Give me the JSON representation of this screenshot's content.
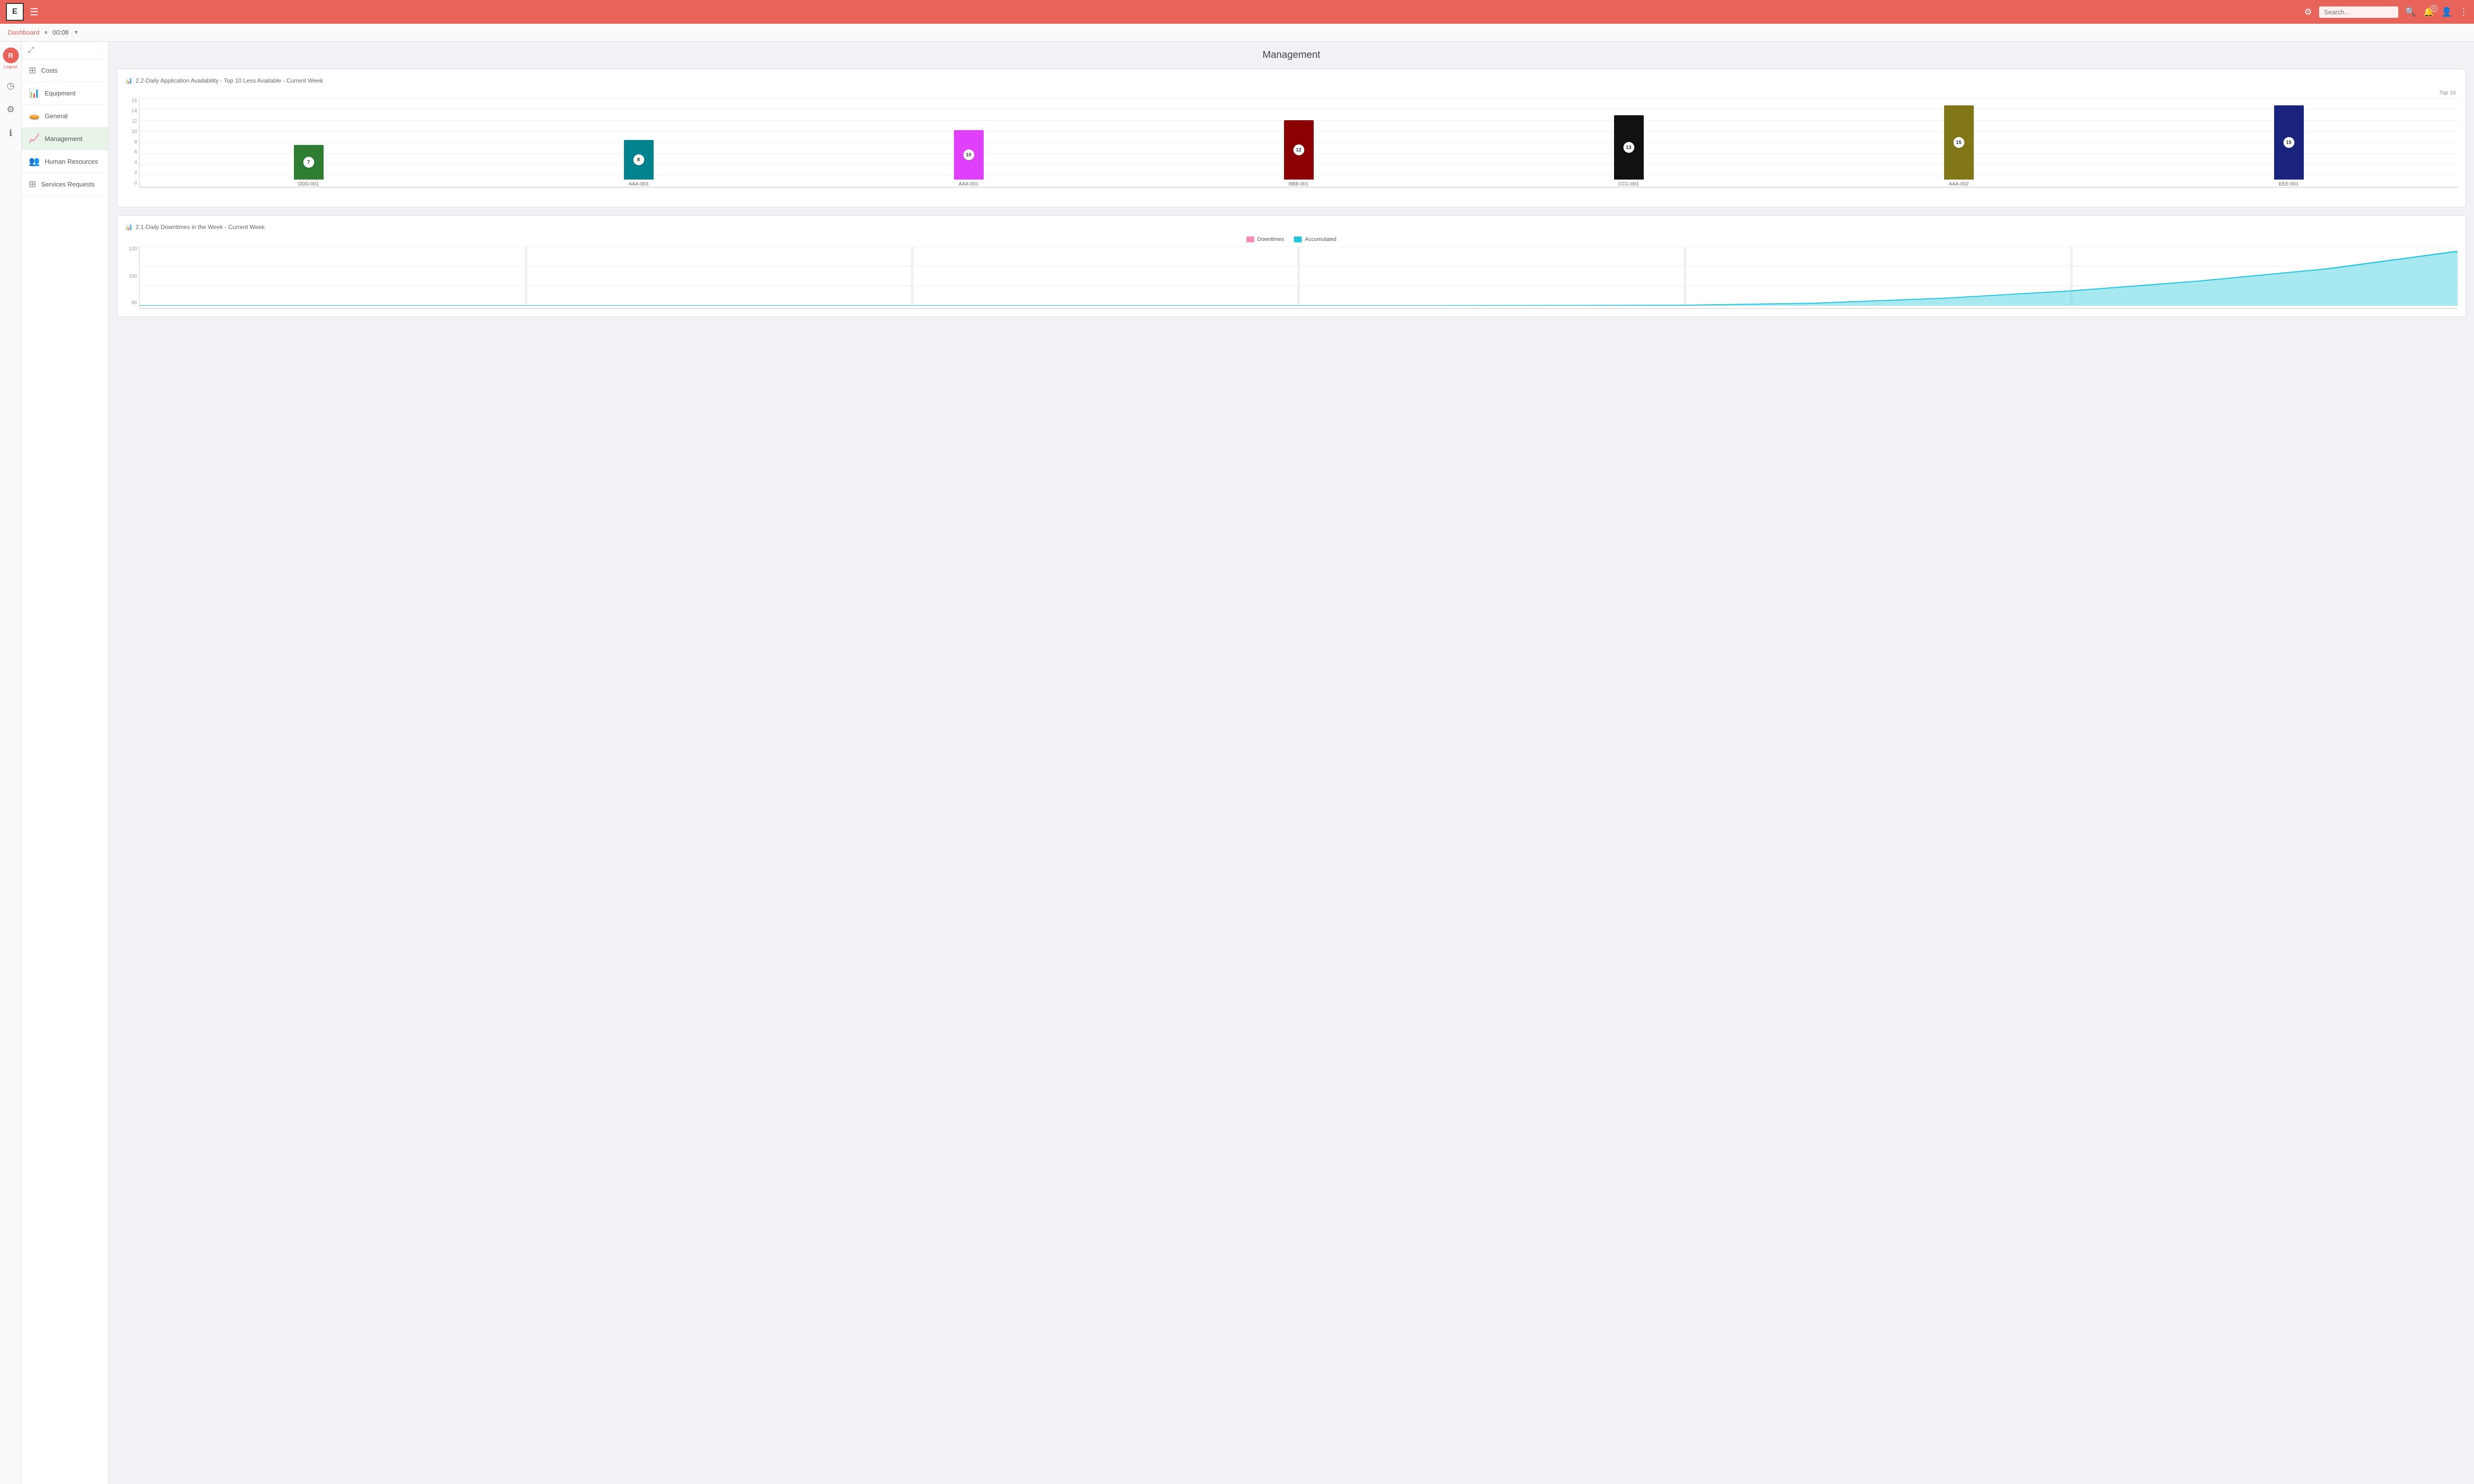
{
  "app": {
    "logo": "E",
    "title": "Management Dashboard"
  },
  "topnav": {
    "hamburger": "☰",
    "search_placeholder": "Search...",
    "settings_icon": "⚙",
    "search_icon": "🔍",
    "bell_icon": "🔔",
    "bell_badge": "0",
    "user_icon": "👤",
    "more_icon": "⋮"
  },
  "breadcrumb": {
    "dashboard_label": "Dashboard",
    "pause_icon": "⏸",
    "time": "00:08",
    "filter_icon": "▼"
  },
  "sidebar_icons": [
    {
      "name": "user-icon",
      "label": "R",
      "sublabel": "Logout",
      "is_user": true
    },
    {
      "name": "clock-icon",
      "label": "◷"
    },
    {
      "name": "settings-icon",
      "label": "⚙"
    },
    {
      "name": "info-icon",
      "label": "ℹ"
    }
  ],
  "nav_items": [
    {
      "id": "costs",
      "label": "Costs",
      "icon": "⊞",
      "icon_color": "#888",
      "active": false
    },
    {
      "id": "equipment",
      "label": "Equipment",
      "icon": "📊",
      "icon_color": "#4472c4",
      "active": false
    },
    {
      "id": "general",
      "label": "General",
      "icon": "🥧",
      "icon_color": "#ed7d31",
      "active": false
    },
    {
      "id": "management",
      "label": "Management",
      "icon": "📈",
      "icon_color": "#70ad47",
      "active": true
    },
    {
      "id": "human-resources",
      "label": "Human Resources",
      "icon": "👥",
      "icon_color": "#4472c4",
      "active": false
    },
    {
      "id": "services-requests",
      "label": "Services Requests",
      "icon": "⊞",
      "icon_color": "#888",
      "active": false
    }
  ],
  "page": {
    "title": "Management",
    "chart1_title": "2.2-Daily Application Availability - Top 10 Less Available - Current Week",
    "chart1_title_icon": "📊",
    "chart1_top_label": "Top 10",
    "chart2_title": "2.1-Daily Downtimes in the Week - Current Week",
    "chart2_title_icon": "📊"
  },
  "bar_chart": {
    "y_max": 16,
    "y_labels": [
      "0",
      "2",
      "4",
      "6",
      "8",
      "10",
      "12",
      "14",
      "16"
    ],
    "bars": [
      {
        "label": "DDD-001",
        "value": 7,
        "color": "#2e7d32",
        "height_pct": 43
      },
      {
        "label": "AAA-003",
        "value": 8,
        "color": "#00838f",
        "height_pct": 50
      },
      {
        "label": "AAA-001",
        "value": 10,
        "color": "#e040fb",
        "height_pct": 62
      },
      {
        "label": "BBB-001",
        "value": 12,
        "color": "#8b0000",
        "height_pct": 75
      },
      {
        "label": "CCC-001",
        "value": 13,
        "color": "#111111",
        "height_pct": 81
      },
      {
        "label": "AAA-002",
        "value": 15,
        "color": "#827717",
        "height_pct": 93
      },
      {
        "label": "EEE-001",
        "value": 15,
        "color": "#1a237e",
        "height_pct": 93
      }
    ]
  },
  "line_chart": {
    "y_max": 120,
    "y_labels": [
      "80",
      "100",
      "120"
    ],
    "legend": [
      {
        "label": "Downtimes",
        "color": "#f48fb1"
      },
      {
        "label": "Accumulated",
        "color": "#26c6da"
      }
    ]
  }
}
